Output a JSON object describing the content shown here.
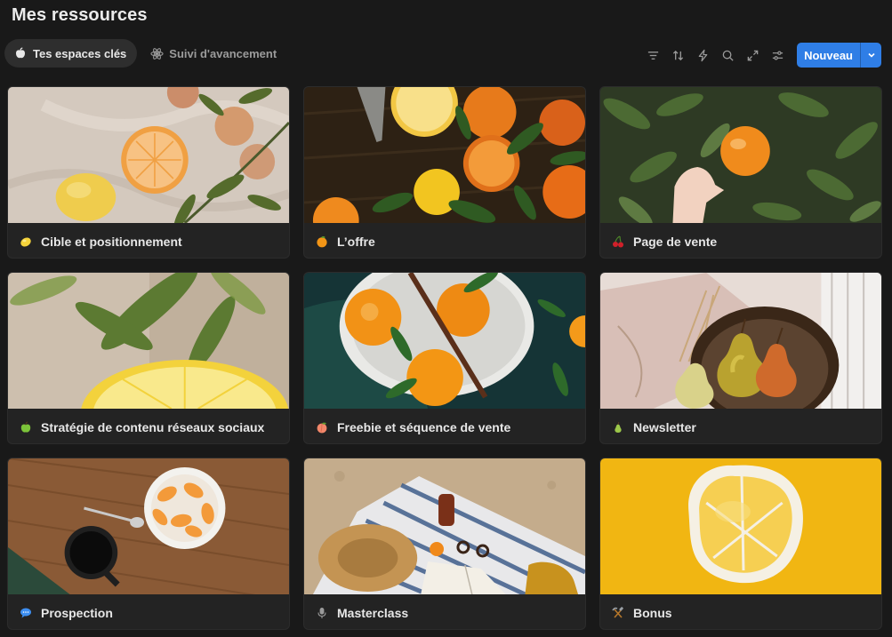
{
  "page": {
    "title": "Mes ressources"
  },
  "tabs": [
    {
      "label": "Tes espaces clés",
      "icon": "apple-icon",
      "active": true
    },
    {
      "label": "Suivi d'avancement",
      "icon": "atom-icon",
      "active": false
    }
  ],
  "toolbar": {
    "tools": [
      "filter-icon",
      "sort-icon",
      "lightning-icon",
      "search-icon",
      "expand-icon",
      "settings-sliders-icon"
    ],
    "new_label": "Nouveau",
    "accent": "#2f7ee6"
  },
  "cards": [
    {
      "label": "Cible et positionnement",
      "icon": "lemon-icon"
    },
    {
      "label": "L’offre",
      "icon": "orange-icon"
    },
    {
      "label": "Page de vente",
      "icon": "cherries-icon"
    },
    {
      "label": "Stratégie de contenu réseaux sociaux",
      "icon": "green-apple-icon"
    },
    {
      "label": "Freebie et séquence de vente",
      "icon": "peach-icon"
    },
    {
      "label": "Newsletter",
      "icon": "pear-icon"
    },
    {
      "label": "Prospection",
      "icon": "speech-bubble-icon"
    },
    {
      "label": "Masterclass",
      "icon": "microphone-icon"
    },
    {
      "label": "Bonus",
      "icon": "hammer-pick-icon"
    }
  ]
}
